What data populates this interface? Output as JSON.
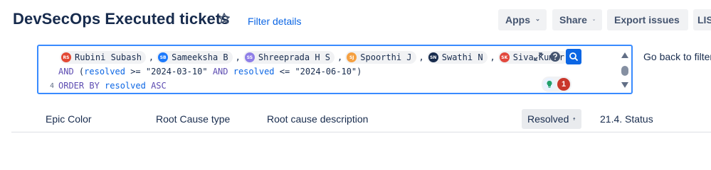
{
  "header": {
    "title": "DevSecOps Executed tickets",
    "star_icon": "star-outline-icon",
    "filter_details": "Filter details",
    "apps": "Apps",
    "share": "Share",
    "export": "Export issues",
    "list": "LIST"
  },
  "editor": {
    "users": [
      {
        "initials": "RS",
        "name": "Rubini Subash",
        "color": "#e34935"
      },
      {
        "initials": "SB",
        "name": "Sameeksha B",
        "color": "#1d7afc"
      },
      {
        "initials": "SS",
        "name": "Shreeprada H S",
        "color": "#8f7ee7"
      },
      {
        "initials": "SJ",
        "name": "Spoorthi J",
        "color": "#f5a041"
      },
      {
        "initials": "SN",
        "name": "Swathi N",
        "color": "#172b4d"
      },
      {
        "initials": "SK",
        "name": "Siva Kumar",
        "color": "#e2483d"
      }
    ],
    "comma": ",",
    "close_paren": ")",
    "line2": {
      "and1": "AND",
      "open": "(",
      "field1": "resolved",
      "op1": ">=",
      "val1": "\"2024-03-10\"",
      "and2": "AND",
      "field2": "resolved",
      "op2": "<=",
      "val2": "\"2024-06-10\"",
      "close": ")"
    },
    "line3": {
      "number": "4",
      "order_by": "ORDER BY",
      "field": "resolved",
      "dir": "ASC"
    },
    "lint_count": "1"
  },
  "go_back": "Go back to filter",
  "table": {
    "columns": [
      "Epic Color",
      "Root Cause type",
      "Root cause description",
      "Resolved",
      "21.4. Status"
    ]
  }
}
